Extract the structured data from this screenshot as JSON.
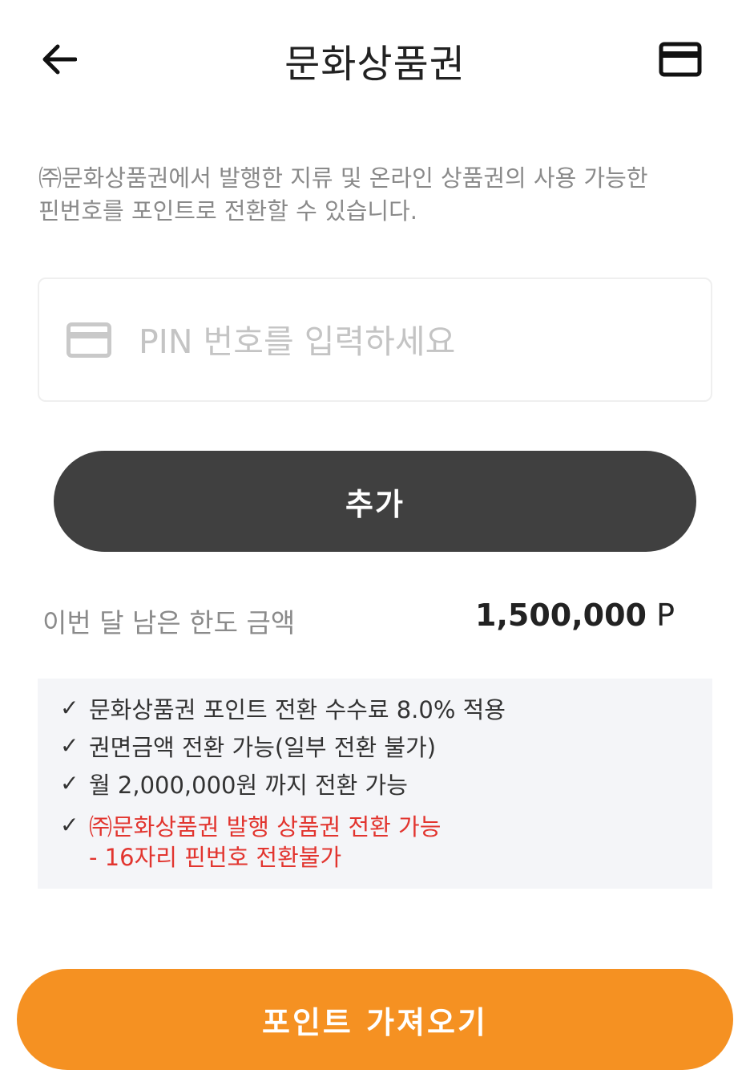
{
  "header": {
    "title": "문화상품권",
    "back_icon": "arrow-left-icon",
    "card_icon": "credit-card-icon"
  },
  "description": {
    "line1": "㈜문화상품권에서 발행한 지류 및 온라인 상품권의 사용 가능한",
    "line2": "핀번호를 포인트로 전환할 수 있습니다."
  },
  "pin": {
    "icon": "credit-card-icon",
    "placeholder": "PIN 번호를 입력하세요",
    "value": ""
  },
  "add_button": {
    "label": "추가"
  },
  "limit": {
    "label": "이번 달 남은 한도 금액",
    "amount": "1,500,000",
    "unit": "P"
  },
  "info": {
    "items": [
      {
        "text": "문화상품권 포인트 전환 수수료 8.0% 적용"
      },
      {
        "text": "권면금액 전환 가능(일부 전환 불가)"
      },
      {
        "text": "월 2,000,000원 까지 전환 가능"
      }
    ],
    "notice": {
      "line1": "㈜문화상품권 발행 상품권 전환 가능",
      "line2": "- 16자리 핀번호 전환불가"
    },
    "check_glyph": "✓"
  },
  "get_button": {
    "label": "포인트 가져오기"
  },
  "colors": {
    "accent": "#f59122",
    "dark_button": "#404040",
    "warning": "#e2352f",
    "info_bg": "#f4f5f8"
  }
}
